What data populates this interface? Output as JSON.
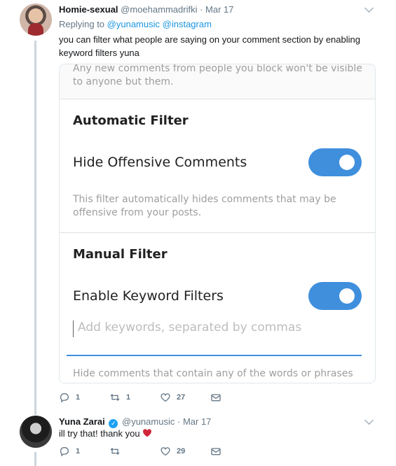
{
  "tweets": [
    {
      "author_name": "Homie-sexual",
      "author_handle": "@moehammadrifki",
      "separator": "·",
      "date": "Mar 17",
      "replying_prefix": "Replying to",
      "replying_to": [
        "@yunamusic",
        "@instagram"
      ],
      "text_line1": "you can filter what people are saying on your comment section by enabling",
      "text_line2": "keyword filters yuna",
      "actions": {
        "replies": "1",
        "retweets": "1",
        "likes": "27"
      }
    },
    {
      "author_name": "Yuna Zarai",
      "author_handle": "@yunamusic",
      "separator": "·",
      "date": "Mar 17",
      "verified": true,
      "text": "ill try that! thank you",
      "actions": {
        "replies": "1",
        "retweets": "",
        "likes": "29"
      }
    }
  ],
  "embedded_screenshot": {
    "top_text": "Any new comments from people you block won't be visible to anyone but them.",
    "automatic_filter": {
      "title": "Automatic Filter",
      "toggle_label": "Hide Offensive Comments",
      "toggle_on": true,
      "description": "This filter automatically hides comments that may be offensive from your posts."
    },
    "manual_filter": {
      "title": "Manual Filter",
      "toggle_label": "Enable Keyword Filters",
      "toggle_on": true,
      "input_placeholder": "Add keywords, separated by commas",
      "description": "Hide comments that contain any of the words or phrases you"
    }
  },
  "colors": {
    "accent": "#1b95e0",
    "toggle_on": "#3f8fdd",
    "heart": "#e0245e"
  },
  "icons": [
    "reply-icon",
    "retweet-icon",
    "like-icon",
    "dm-icon",
    "caret-down-icon",
    "verified-icon",
    "heart-emoji"
  ]
}
